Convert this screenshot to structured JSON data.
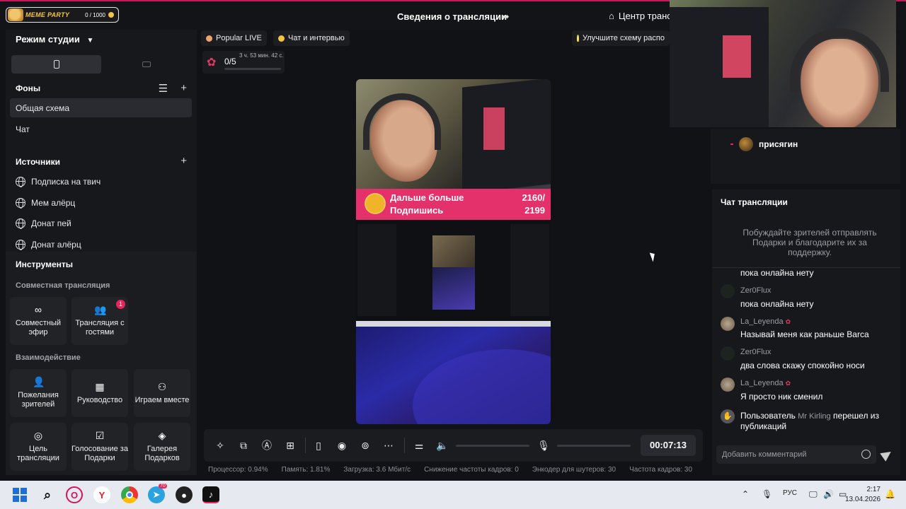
{
  "topbar": {
    "logo_text": "MEME PARTY",
    "logo_count": "0 / 1000",
    "title": "Сведения о трансляции",
    "center_label": "Центр транс"
  },
  "left": {
    "studio_mode": "Режим студии",
    "backgrounds_title": "Фоны",
    "backgrounds": [
      "Общая схема",
      "Чат"
    ],
    "sources_title": "Источники",
    "sources": [
      "Подписка на твич",
      "Мем алёрц",
      "Донат пей",
      "Донат алёрц"
    ],
    "tools_title": "Инструменты",
    "joint_title": "Совместная трансляция",
    "joint_tiles": [
      "Совместный эфир",
      "Трансляция с гостями"
    ],
    "guests_badge": "1",
    "interaction_title": "Взаимодействие",
    "interaction_tiles": [
      "Пожелания зрителей",
      "Руководство",
      "Играем вместе",
      "Цель трансляции",
      "Голосование за Подарки",
      "Галерея Подарков"
    ]
  },
  "center": {
    "chip_popular": "Popular LIVE",
    "chip_chat": "Чат и интервью",
    "chip_improve": "Улучшите схему распо",
    "goal_count": "0/5",
    "goal_time": "3 ч. 53 мин. 42 с.",
    "banner_line1": "Дальше больше",
    "banner_line2": "Подпишись",
    "banner_num1": "2160/",
    "banner_num2": "2199",
    "timer": "00:07:13",
    "stats": [
      "Процессор: 0.94%",
      "Память: 1.81%",
      "Загрузка: 3.6 Мбит/с",
      "Снижение частоты кадров: 0",
      "Энкодер для шутеров: 30",
      "Частота кадров: 30"
    ]
  },
  "right": {
    "viewer_name": "присягин",
    "chat_title": "Чат трансляции",
    "chat_hint": "Побуждайте зрителей отправлять Подарки и благодарите их за поддержку.",
    "partial_message": "пока онлайна нету",
    "messages": [
      {
        "name": "Zer0Flux",
        "text": "пока онлайна нету"
      },
      {
        "name": "La_Leyenda",
        "text": "Называй меня как раньше Barca"
      },
      {
        "name": "Zer0Flux",
        "text": "два слова скажу спокойно носи"
      },
      {
        "name": "La_Leyenda",
        "text": "Я просто ник сменил"
      }
    ],
    "system_prefix": "Пользователь",
    "system_user": "Mr Kirling",
    "system_action": "перешел из",
    "system_line2": "публикаций",
    "comment_placeholder": "Добавить комментарий"
  },
  "taskbar": {
    "lang": "РУС",
    "time": "2:17",
    "date": "13.04.2026",
    "telegram_badge": "70"
  },
  "colors": {
    "accent": "#e4306b",
    "badge": "#e8245a",
    "panel": "#17181c",
    "background": "#111216"
  }
}
